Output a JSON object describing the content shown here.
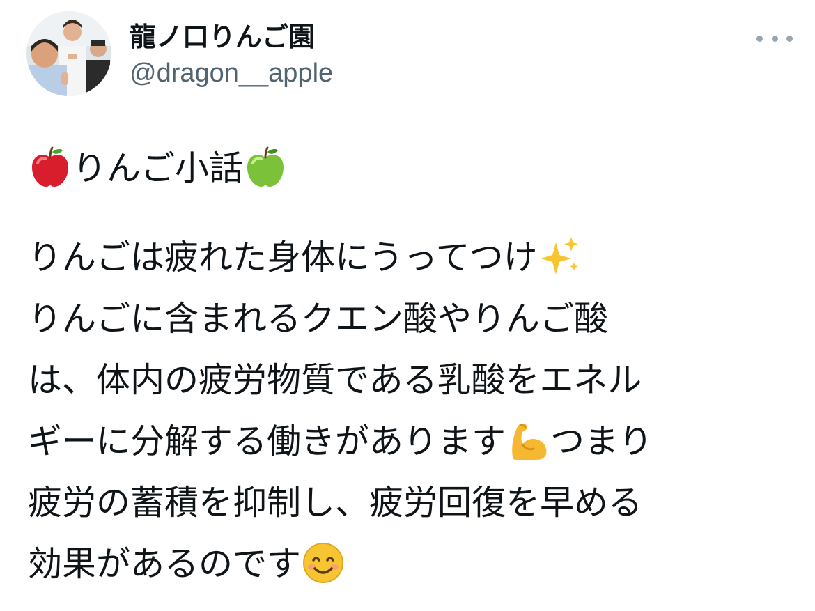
{
  "author": {
    "display_name": "龍ノ口りんご園",
    "handle": "@dragon__apple",
    "avatar_icon": "profile-photo-three-people"
  },
  "menu": {
    "icon": "more-horizontal-icon"
  },
  "tweet": {
    "title_line": {
      "leading_emoji": "red-apple",
      "text": "りんご小話",
      "trailing_emoji": "green-apple"
    },
    "lines": [
      {
        "text": "りんごは疲れた身体にうってつけ",
        "emoji_after": "sparkles"
      },
      {
        "text": "りんごに含まれるクエン酸やりんご酸"
      },
      {
        "text": "は、体内の疲労物質である乳酸をエネル"
      },
      {
        "text": "ギーに分解する働きがあります",
        "emoji_after": "flexed-biceps",
        "text_after": "つまり"
      },
      {
        "text": "疲労の蓄積を抑制し、疲労回復を早める"
      },
      {
        "text": "効果があるのです",
        "emoji_after": "smiling-face"
      }
    ]
  },
  "colors": {
    "text_primary": "#0f1419",
    "text_secondary": "#536471",
    "dots": "#9aa5ae"
  }
}
